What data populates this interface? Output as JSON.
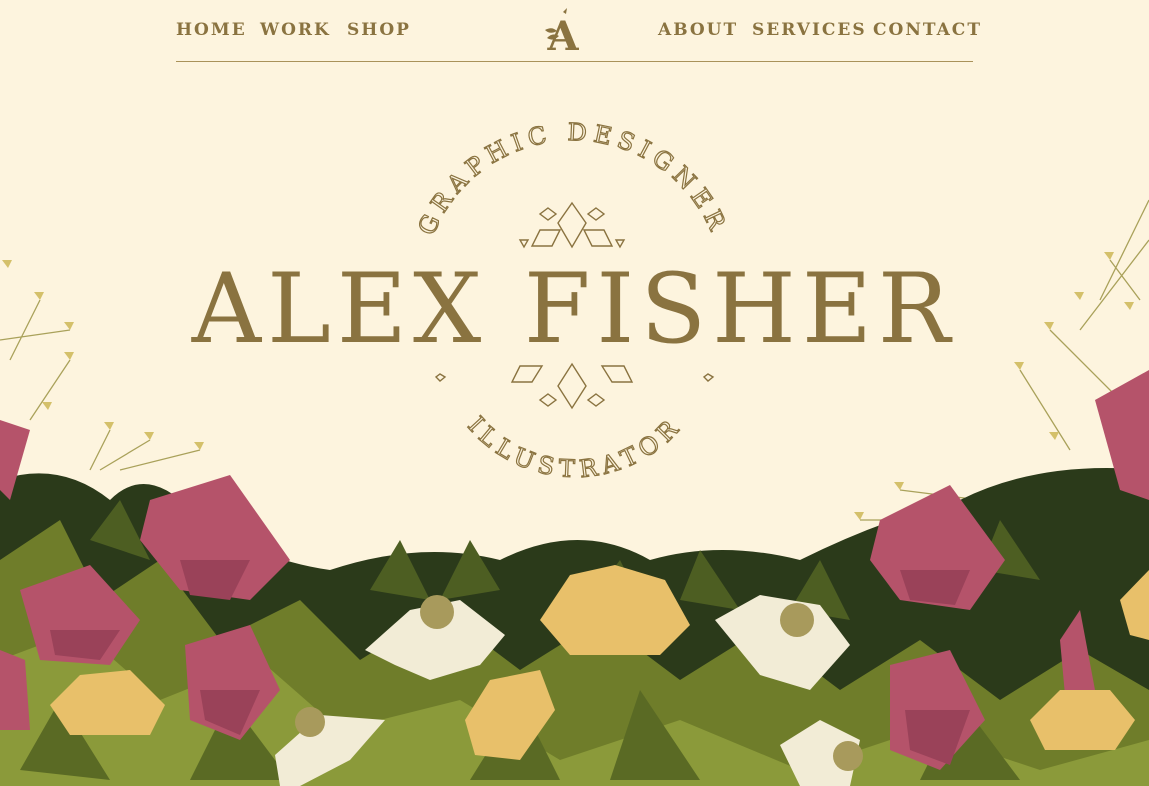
{
  "nav": {
    "left": [
      "HOME",
      "WORK",
      "SHOP"
    ],
    "right": [
      "ABOUT",
      "SERVICES",
      "CONTACT"
    ],
    "logo_letter": "A"
  },
  "hero": {
    "name": "ALEX FISHER",
    "top_arc": "GRAPHIC DESIGNER",
    "bottom_arc": "ILLUSTRATOR"
  },
  "colors": {
    "background": "#fdf4de",
    "text": "#8a7340",
    "rose": "#b5536a",
    "leaf_dark": "#2b3a1a",
    "leaf_light": "#8b9a3a",
    "daisy": "#f2ecd6",
    "marigold": "#e8c06a"
  }
}
